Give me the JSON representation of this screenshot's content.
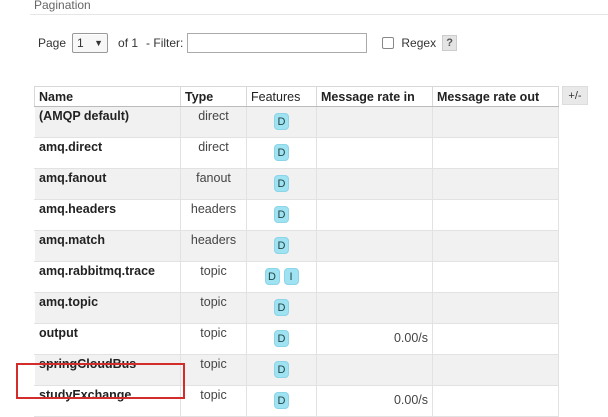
{
  "section": {
    "title": "Pagination"
  },
  "pagination": {
    "page_label": "Page",
    "page_value": "1",
    "of_text": "of 1",
    "filter_label": "- Filter:",
    "filter_value": "",
    "regex_label": "Regex",
    "help_label": "?"
  },
  "table": {
    "headers": [
      "Name",
      "Type",
      "Features",
      "Message rate in",
      "Message rate out"
    ],
    "toggle_label": "+/-",
    "rows": [
      {
        "name": "(AMQP default)",
        "type": "direct",
        "features": [
          "D"
        ],
        "rate_in": "",
        "rate_out": ""
      },
      {
        "name": "amq.direct",
        "type": "direct",
        "features": [
          "D"
        ],
        "rate_in": "",
        "rate_out": ""
      },
      {
        "name": "amq.fanout",
        "type": "fanout",
        "features": [
          "D"
        ],
        "rate_in": "",
        "rate_out": ""
      },
      {
        "name": "amq.headers",
        "type": "headers",
        "features": [
          "D"
        ],
        "rate_in": "",
        "rate_out": ""
      },
      {
        "name": "amq.match",
        "type": "headers",
        "features": [
          "D"
        ],
        "rate_in": "",
        "rate_out": ""
      },
      {
        "name": "amq.rabbitmq.trace",
        "type": "topic",
        "features": [
          "D",
          "I"
        ],
        "rate_in": "",
        "rate_out": ""
      },
      {
        "name": "amq.topic",
        "type": "topic",
        "features": [
          "D"
        ],
        "rate_in": "",
        "rate_out": ""
      },
      {
        "name": "output",
        "type": "topic",
        "features": [
          "D"
        ],
        "rate_in": "0.00/s",
        "rate_out": ""
      },
      {
        "name": "springCloudBus",
        "type": "topic",
        "features": [
          "D"
        ],
        "rate_in": "",
        "rate_out": ""
      },
      {
        "name": "studyExchange",
        "type": "topic",
        "features": [
          "D"
        ],
        "rate_in": "0.00/s",
        "rate_out": ""
      }
    ]
  },
  "colors": {
    "feature_badge": "#9fe2f2",
    "highlight": "#d42b2b"
  }
}
